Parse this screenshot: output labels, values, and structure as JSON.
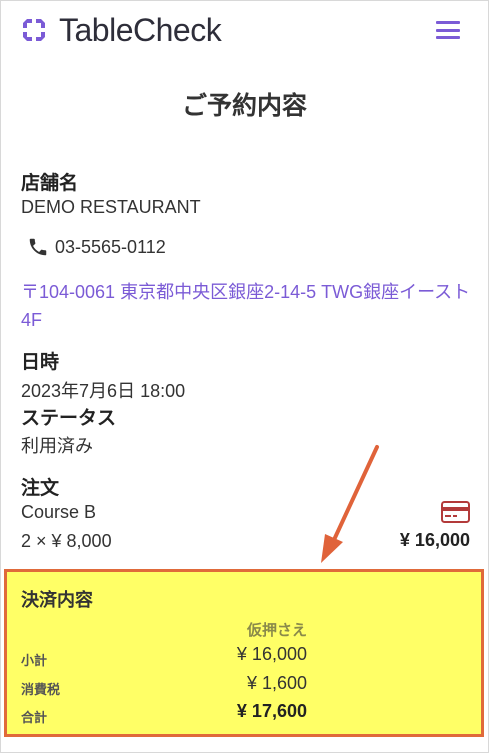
{
  "header": {
    "brand": "TableCheck",
    "menu_icon": "hamburger-menu-icon",
    "accent_color": "#7b5bd6"
  },
  "page_title": "ご予約内容",
  "restaurant": {
    "label": "店舗名",
    "name": "DEMO RESTAURANT",
    "phone": "03-5565-0112",
    "address": "〒104-0061 東京都中央区銀座2-14-5 TWG銀座イースト4F"
  },
  "datetime": {
    "label": "日時",
    "value": "2023年7月6日 18:00"
  },
  "status": {
    "label": "ステータス",
    "value": "利用済み"
  },
  "order": {
    "label": "注文",
    "item_name": "Course B",
    "item_qty_price": "2 × ¥ 8,000",
    "item_total": "¥ 16,000",
    "payment_icon": "credit-card-icon"
  },
  "payment": {
    "title": "決済内容",
    "column_header": "仮押さえ",
    "rows": [
      {
        "label": "小計",
        "value": "¥ 16,000"
      },
      {
        "label": "消費税",
        "value": "¥ 1,600"
      },
      {
        "label": "合計",
        "value": "¥ 17,600"
      }
    ],
    "highlight_color": "#ffff66",
    "border_color": "#e06a3a"
  }
}
